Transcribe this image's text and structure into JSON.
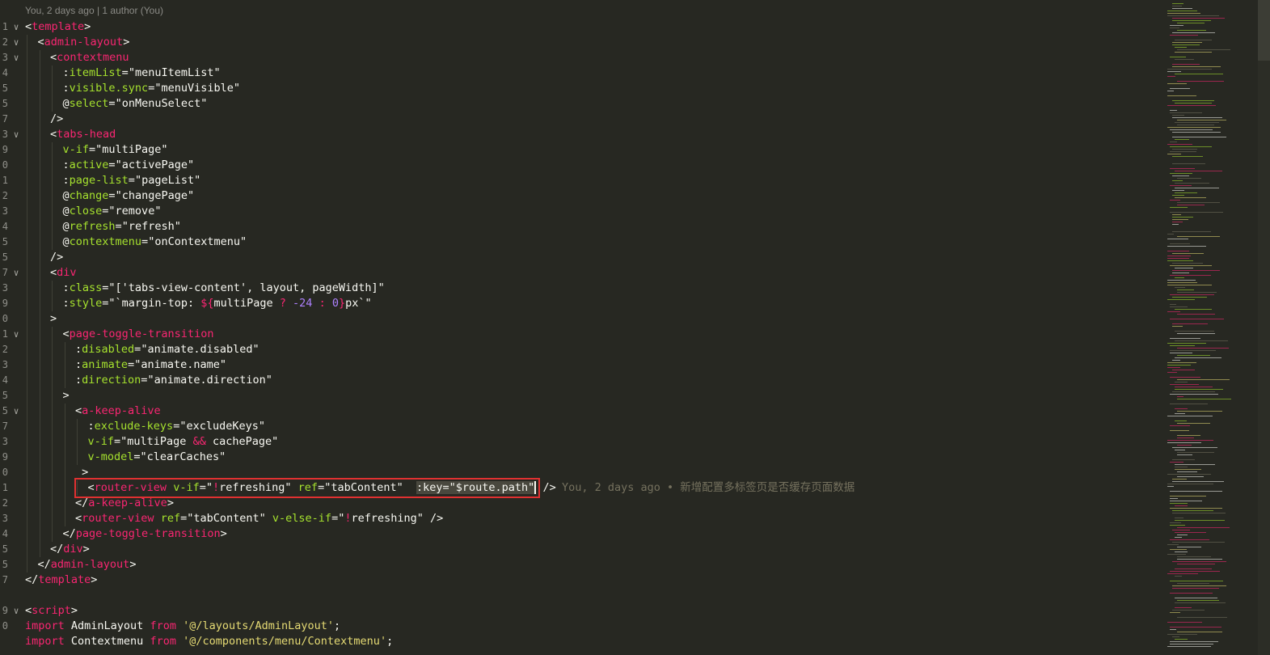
{
  "codelens": "You, 2 days ago | 1 author (You)",
  "blame": "You, 2 days ago • 新增配置多标签页是否缓存页面数据",
  "colors": {
    "background": "#272822",
    "tag": "#f92672",
    "attr": "#a6e22e",
    "string": "#e6db74",
    "number": "#ae81ff",
    "highlight_box": "#e03131"
  },
  "lines": [
    {
      "n": "1",
      "fold": true,
      "indent": 0,
      "segs": [
        [
          "pun",
          "<"
        ],
        [
          "tag",
          "template"
        ],
        [
          "pun",
          ">"
        ]
      ]
    },
    {
      "n": "2",
      "fold": true,
      "indent": 1,
      "segs": [
        [
          "pun",
          "<"
        ],
        [
          "tag",
          "admin-layout"
        ],
        [
          "pun",
          ">"
        ]
      ]
    },
    {
      "n": "3",
      "fold": true,
      "indent": 2,
      "segs": [
        [
          "pun",
          "<"
        ],
        [
          "tag",
          "contextmenu"
        ]
      ]
    },
    {
      "n": "4",
      "fold": false,
      "indent": 3,
      "segs": [
        [
          "pun",
          ":"
        ],
        [
          "attr",
          "itemList"
        ],
        [
          "pun",
          "="
        ],
        [
          "str",
          "\"menuItemList\""
        ]
      ]
    },
    {
      "n": "5",
      "fold": false,
      "indent": 3,
      "segs": [
        [
          "pun",
          ":"
        ],
        [
          "attr",
          "visible.sync"
        ],
        [
          "pun",
          "="
        ],
        [
          "str",
          "\"menuVisible\""
        ]
      ]
    },
    {
      "n": "5",
      "fold": false,
      "indent": 3,
      "segs": [
        [
          "pun",
          "@"
        ],
        [
          "attr",
          "select"
        ],
        [
          "pun",
          "="
        ],
        [
          "str",
          "\"onMenuSelect\""
        ]
      ]
    },
    {
      "n": "7",
      "fold": false,
      "indent": 2,
      "segs": [
        [
          "pun",
          "/>"
        ]
      ]
    },
    {
      "n": "3",
      "fold": true,
      "indent": 2,
      "segs": [
        [
          "pun",
          "<"
        ],
        [
          "tag",
          "tabs-head"
        ]
      ]
    },
    {
      "n": "9",
      "fold": false,
      "indent": 3,
      "segs": [
        [
          "attr",
          "v-if"
        ],
        [
          "pun",
          "="
        ],
        [
          "str",
          "\"multiPage\""
        ]
      ]
    },
    {
      "n": "0",
      "fold": false,
      "indent": 3,
      "segs": [
        [
          "pun",
          ":"
        ],
        [
          "attr",
          "active"
        ],
        [
          "pun",
          "="
        ],
        [
          "str",
          "\"activePage\""
        ]
      ]
    },
    {
      "n": "1",
      "fold": false,
      "indent": 3,
      "segs": [
        [
          "pun",
          ":"
        ],
        [
          "attr",
          "page-list"
        ],
        [
          "pun",
          "="
        ],
        [
          "str",
          "\"pageList\""
        ]
      ]
    },
    {
      "n": "2",
      "fold": false,
      "indent": 3,
      "segs": [
        [
          "pun",
          "@"
        ],
        [
          "attr",
          "change"
        ],
        [
          "pun",
          "="
        ],
        [
          "str",
          "\"changePage\""
        ]
      ]
    },
    {
      "n": "3",
      "fold": false,
      "indent": 3,
      "segs": [
        [
          "pun",
          "@"
        ],
        [
          "attr",
          "close"
        ],
        [
          "pun",
          "="
        ],
        [
          "str",
          "\"remove\""
        ]
      ]
    },
    {
      "n": "4",
      "fold": false,
      "indent": 3,
      "segs": [
        [
          "pun",
          "@"
        ],
        [
          "attr",
          "refresh"
        ],
        [
          "pun",
          "="
        ],
        [
          "str",
          "\"refresh\""
        ]
      ]
    },
    {
      "n": "5",
      "fold": false,
      "indent": 3,
      "segs": [
        [
          "pun",
          "@"
        ],
        [
          "attr",
          "contextmenu"
        ],
        [
          "pun",
          "="
        ],
        [
          "str",
          "\"onContextmenu\""
        ]
      ]
    },
    {
      "n": "5",
      "fold": false,
      "indent": 2,
      "segs": [
        [
          "pun",
          "/>"
        ]
      ]
    },
    {
      "n": "7",
      "fold": true,
      "indent": 2,
      "segs": [
        [
          "pun",
          "<"
        ],
        [
          "tag",
          "div"
        ]
      ]
    },
    {
      "n": "3",
      "fold": false,
      "indent": 3,
      "segs": [
        [
          "pun",
          ":"
        ],
        [
          "attr",
          "class"
        ],
        [
          "pun",
          "="
        ],
        [
          "str",
          "\"['tabs-view-content', layout, pageWidth]\""
        ]
      ]
    },
    {
      "n": "9",
      "fold": false,
      "indent": 3,
      "segs": [
        [
          "pun",
          ":"
        ],
        [
          "attr",
          "style"
        ],
        [
          "pun",
          "="
        ],
        [
          "str",
          "\"`margin-top: "
        ],
        [
          "op",
          "${"
        ],
        [
          "str",
          "multiPage "
        ],
        [
          "op",
          "?"
        ],
        [
          "str",
          " "
        ],
        [
          "num",
          "-24"
        ],
        [
          "str",
          " "
        ],
        [
          "op",
          ":"
        ],
        [
          "str",
          " "
        ],
        [
          "num",
          "0"
        ],
        [
          "op",
          "}"
        ],
        [
          "str",
          "px`\""
        ]
      ]
    },
    {
      "n": "0",
      "fold": false,
      "indent": 2,
      "segs": [
        [
          "pun",
          ">"
        ]
      ]
    },
    {
      "n": "1",
      "fold": true,
      "indent": 3,
      "segs": [
        [
          "pun",
          "<"
        ],
        [
          "tag",
          "page-toggle-transition"
        ]
      ]
    },
    {
      "n": "2",
      "fold": false,
      "indent": 4,
      "segs": [
        [
          "pun",
          ":"
        ],
        [
          "attr",
          "disabled"
        ],
        [
          "pun",
          "="
        ],
        [
          "str",
          "\"animate.disabled\""
        ]
      ]
    },
    {
      "n": "3",
      "fold": false,
      "indent": 4,
      "segs": [
        [
          "pun",
          ":"
        ],
        [
          "attr",
          "animate"
        ],
        [
          "pun",
          "="
        ],
        [
          "str",
          "\"animate.name\""
        ]
      ]
    },
    {
      "n": "4",
      "fold": false,
      "indent": 4,
      "segs": [
        [
          "pun",
          ":"
        ],
        [
          "attr",
          "direction"
        ],
        [
          "pun",
          "="
        ],
        [
          "str",
          "\"animate.direction\""
        ]
      ]
    },
    {
      "n": "5",
      "fold": false,
      "indent": 3,
      "segs": [
        [
          "pun",
          ">"
        ]
      ]
    },
    {
      "n": "5",
      "fold": true,
      "indent": 4,
      "segs": [
        [
          "pun",
          "<"
        ],
        [
          "tag",
          "a-keep-alive"
        ]
      ]
    },
    {
      "n": "7",
      "fold": false,
      "indent": 5,
      "segs": [
        [
          "pun",
          ":"
        ],
        [
          "attr",
          "exclude-keys"
        ],
        [
          "pun",
          "="
        ],
        [
          "str",
          "\"excludeKeys\""
        ]
      ]
    },
    {
      "n": "3",
      "fold": false,
      "indent": 5,
      "segs": [
        [
          "attr",
          "v-if"
        ],
        [
          "pun",
          "="
        ],
        [
          "str",
          "\"multiPage "
        ],
        [
          "op",
          "&&"
        ],
        [
          "str",
          " cachePage\""
        ]
      ]
    },
    {
      "n": "9",
      "fold": false,
      "indent": 5,
      "segs": [
        [
          "attr",
          "v-model"
        ],
        [
          "pun",
          "="
        ],
        [
          "str",
          "\"clearCaches\""
        ]
      ]
    },
    {
      "n": "0",
      "fold": false,
      "indent": 4,
      "segs": [
        [
          "pun",
          " >"
        ]
      ]
    },
    {
      "n": "1",
      "fold": false,
      "indent": 5,
      "highlight": true,
      "segs": [
        [
          "pun",
          "<"
        ],
        [
          "tag",
          "router-view"
        ],
        [
          "pun",
          " "
        ],
        [
          "attr",
          "v-if"
        ],
        [
          "pun",
          "="
        ],
        [
          "str",
          "\""
        ],
        [
          "op",
          "!"
        ],
        [
          "str",
          "refreshing\""
        ],
        [
          "pun",
          " "
        ],
        [
          "attr",
          "ref"
        ],
        [
          "pun",
          "="
        ],
        [
          "str",
          "\"tabContent\""
        ],
        [
          "pun",
          "  "
        ],
        [
          "hl",
          ":key=\"$route.path\""
        ],
        [
          "cur",
          ""
        ],
        [
          "pun",
          " />"
        ]
      ]
    },
    {
      "n": "2",
      "fold": false,
      "indent": 4,
      "segs": [
        [
          "pun",
          "</"
        ],
        [
          "tag",
          "a-keep-alive"
        ],
        [
          "pun",
          ">"
        ]
      ]
    },
    {
      "n": "3",
      "fold": false,
      "indent": 4,
      "segs": [
        [
          "pun",
          "<"
        ],
        [
          "tag",
          "router-view"
        ],
        [
          "pun",
          " "
        ],
        [
          "attr",
          "ref"
        ],
        [
          "pun",
          "="
        ],
        [
          "str",
          "\"tabContent\""
        ],
        [
          "pun",
          " "
        ],
        [
          "attr",
          "v-else-if"
        ],
        [
          "pun",
          "="
        ],
        [
          "str",
          "\""
        ],
        [
          "op",
          "!"
        ],
        [
          "str",
          "refreshing\""
        ],
        [
          "pun",
          " />"
        ]
      ]
    },
    {
      "n": "4",
      "fold": false,
      "indent": 3,
      "segs": [
        [
          "pun",
          "</"
        ],
        [
          "tag",
          "page-toggle-transition"
        ],
        [
          "pun",
          ">"
        ]
      ]
    },
    {
      "n": "5",
      "fold": false,
      "indent": 2,
      "segs": [
        [
          "pun",
          "</"
        ],
        [
          "tag",
          "div"
        ],
        [
          "pun",
          ">"
        ]
      ]
    },
    {
      "n": "5",
      "fold": false,
      "indent": 1,
      "segs": [
        [
          "pun",
          "</"
        ],
        [
          "tag",
          "admin-layout"
        ],
        [
          "pun",
          ">"
        ]
      ]
    },
    {
      "n": "7",
      "fold": false,
      "indent": 0,
      "segs": [
        [
          "pun",
          "</"
        ],
        [
          "tag",
          "template"
        ],
        [
          "pun",
          ">"
        ]
      ]
    },
    {
      "n": "",
      "fold": false,
      "indent": 0,
      "segs": []
    },
    {
      "n": "9",
      "fold": true,
      "indent": 0,
      "segs": [
        [
          "pun",
          "<"
        ],
        [
          "tag",
          "script"
        ],
        [
          "pun",
          ">"
        ]
      ]
    },
    {
      "n": "0",
      "fold": false,
      "indent": 0,
      "segs": [
        [
          "kw",
          "import"
        ],
        [
          "pun",
          " AdminLayout "
        ],
        [
          "kw",
          "from"
        ],
        [
          "pun",
          " "
        ],
        [
          "qt",
          "'@/layouts/AdminLayout'"
        ],
        [
          "pun",
          ";"
        ]
      ]
    },
    {
      "n": "",
      "fold": false,
      "indent": 0,
      "segs": [
        [
          "kw",
          "import"
        ],
        [
          "pun",
          " Contextmenu "
        ],
        [
          "kw",
          "from"
        ],
        [
          "pun",
          " "
        ],
        [
          "qt",
          "'@/components/menu/Contextmenu'"
        ],
        [
          "pun",
          ";"
        ]
      ]
    }
  ]
}
